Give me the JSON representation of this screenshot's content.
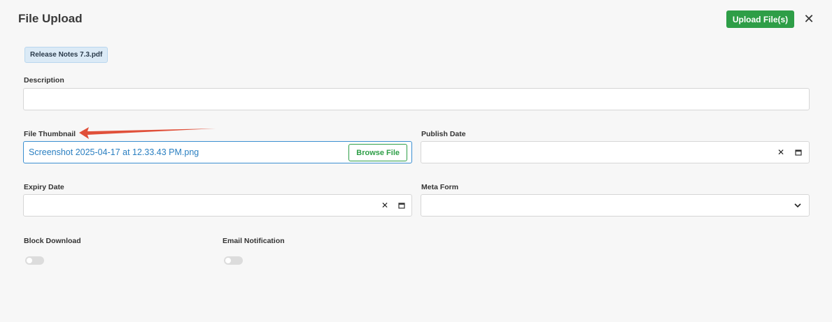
{
  "header": {
    "title": "File Upload",
    "upload_label": "Upload File(s)",
    "close_glyph": "✕"
  },
  "attachment": {
    "filename": "Release Notes 7.3.pdf"
  },
  "form": {
    "description": {
      "label": "Description",
      "value": ""
    },
    "file_thumbnail": {
      "label": "File Thumbnail",
      "value": "Screenshot 2025-04-17 at 12.33.43 PM.png",
      "browse_label": "Browse File"
    },
    "publish_date": {
      "label": "Publish Date",
      "value": "",
      "clear_glyph": "✕"
    },
    "expiry_date": {
      "label": "Expiry Date",
      "value": "",
      "clear_glyph": "✕"
    },
    "meta_form": {
      "label": "Meta Form",
      "value": ""
    },
    "block_download": {
      "label": "Block Download",
      "enabled": false
    },
    "email_notification": {
      "label": "Email Notification",
      "enabled": false
    }
  },
  "colors": {
    "accent_green": "#2e9e47",
    "link_blue": "#2a7fc1",
    "annotation_arrow": "#e0503a",
    "chip_bg": "#dbeaf6"
  }
}
